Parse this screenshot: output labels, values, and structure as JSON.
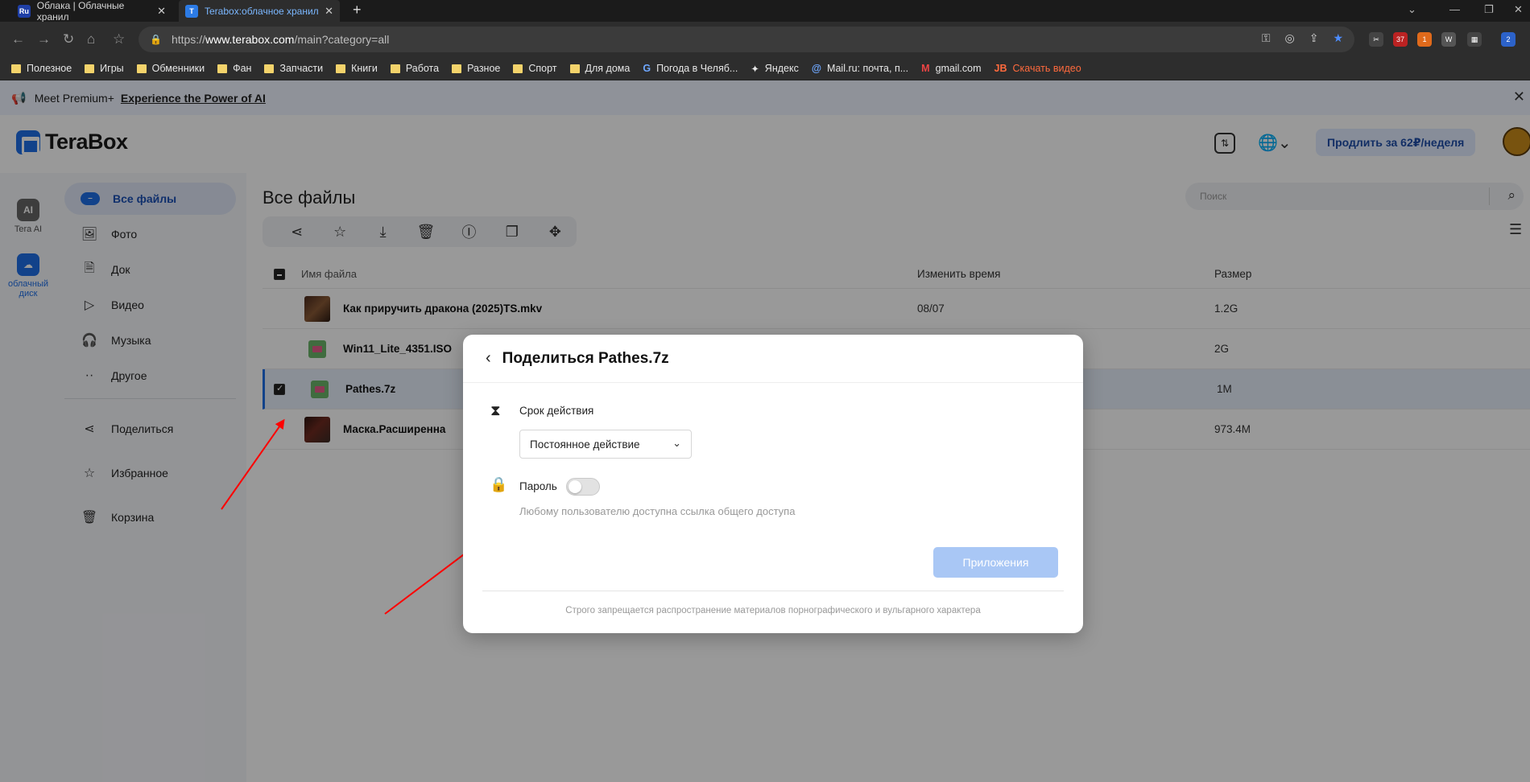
{
  "browser": {
    "tabs": [
      {
        "label": "Облака | Облачные хранил",
        "favicon": "Ru"
      },
      {
        "label": "Terabox:облачное хранил",
        "favicon": "T"
      }
    ],
    "url": {
      "prefix": "https://",
      "host": "www.terabox.com",
      "path": "/main?category=all"
    },
    "bookmarks": [
      {
        "label": "Полезное",
        "icon": "folder"
      },
      {
        "label": "Игры",
        "icon": "folder"
      },
      {
        "label": "Обменники",
        "icon": "folder"
      },
      {
        "label": "Фан",
        "icon": "folder"
      },
      {
        "label": "Запчасти",
        "icon": "folder"
      },
      {
        "label": "Книги",
        "icon": "folder"
      },
      {
        "label": "Работа",
        "icon": "folder"
      },
      {
        "label": "Разное",
        "icon": "folder"
      },
      {
        "label": "Спорт",
        "icon": "folder"
      },
      {
        "label": "Для дома",
        "icon": "folder"
      },
      {
        "label": "Погода в Челяб...",
        "icon": "G"
      },
      {
        "label": "Яндекс",
        "icon": "✦"
      },
      {
        "label": "Mail.ru: почта, п...",
        "icon": "@"
      },
      {
        "label": "gmail.com",
        "icon": "M"
      },
      {
        "label": "Скачать видео",
        "icon": "JB"
      }
    ],
    "extension_badges": [
      "37",
      "1",
      "2"
    ]
  },
  "promo": {
    "prefix": "Meet Premium+",
    "link": "Experience the Power of AI"
  },
  "header": {
    "brand": "TeraBox",
    "upgrade_label": "Продлить за 62₽/неделя"
  },
  "rail": {
    "items": [
      {
        "label": "Tera AI",
        "icon": "AI"
      },
      {
        "label": "облачный диск",
        "icon": "cloud"
      }
    ]
  },
  "sidebar": {
    "items": [
      {
        "label": "Все файлы",
        "icon": "all-files-icon"
      },
      {
        "label": "Фото",
        "icon": "photo-icon"
      },
      {
        "label": "Док",
        "icon": "doc-icon"
      },
      {
        "label": "Видео",
        "icon": "video-icon"
      },
      {
        "label": "Музыка",
        "icon": "headphones-icon"
      },
      {
        "label": "Другое",
        "icon": "more-icon"
      },
      {
        "label": "Поделиться",
        "icon": "share-icon"
      },
      {
        "label": "Избранное",
        "icon": "star-icon"
      },
      {
        "label": "Корзина",
        "icon": "trash-icon"
      }
    ]
  },
  "main": {
    "title": "Все файлы",
    "search_placeholder": "Поиск",
    "columns": {
      "name": "Имя файла",
      "time": "Изменить время",
      "size": "Размер"
    },
    "files": [
      {
        "name": "Как приручить дракона (2025)TS.mkv",
        "time": "08/07",
        "size": "1.2G",
        "thumb": "movie",
        "selected": false
      },
      {
        "name": "Win11_Lite_4351.ISO",
        "time": "",
        "size": "2G",
        "thumb": "zip",
        "selected": false
      },
      {
        "name": "Pathes.7z",
        "time": "",
        "size": "1M",
        "thumb": "zip",
        "selected": true
      },
      {
        "name": "Маска.Расширенна",
        "time": "",
        "size": "973.4M",
        "thumb": "movie2",
        "selected": false
      }
    ]
  },
  "modal": {
    "title": "Поделиться Pathes.7z",
    "validity_label": "Срок действия",
    "validity_value": "Постоянное действие",
    "password_label": "Пароль",
    "password_enabled": false,
    "hint": "Любому пользователю доступна ссылка общего доступа",
    "apply_label": "Приложения",
    "disclaimer": "Строго запрещается распространение материалов порнографического и вульгарного характера"
  },
  "colors": {
    "accent": "#1f6fe6",
    "annotation_arrow": "#ff0000"
  }
}
